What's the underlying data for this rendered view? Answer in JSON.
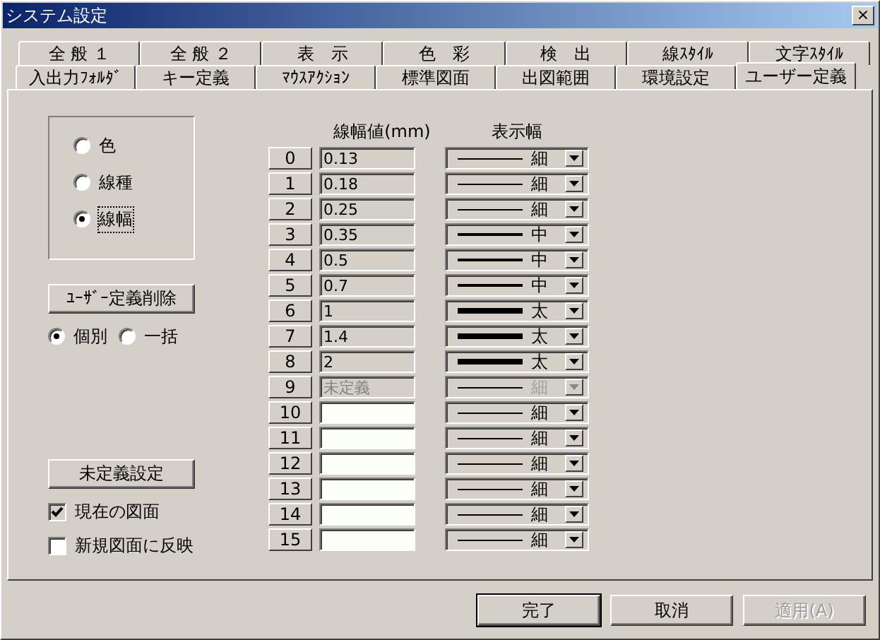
{
  "window": {
    "title": "システム設定",
    "close": "×"
  },
  "tab_rows": [
    [
      {
        "label": "全 般 １",
        "selected": false
      },
      {
        "label": "全 般 ２",
        "selected": false
      },
      {
        "label": "表　示",
        "selected": false
      },
      {
        "label": "色　彩",
        "selected": false
      },
      {
        "label": "検　出",
        "selected": false
      },
      {
        "label": "線ｽﾀｲﾙ",
        "selected": false
      },
      {
        "label": "文字ｽﾀｲﾙ",
        "selected": false
      }
    ],
    [
      {
        "label": "入出力ﾌｫﾙﾀﾞ",
        "selected": false
      },
      {
        "label": "キー定義",
        "selected": false
      },
      {
        "label": "ﾏｳｽｱｸｼｮﾝ",
        "selected": false
      },
      {
        "label": "標準図面",
        "selected": false
      },
      {
        "label": "出図範囲",
        "selected": false
      },
      {
        "label": "環境設定",
        "selected": false
      },
      {
        "label": "ユーザー定義",
        "selected": true
      }
    ]
  ],
  "target_options": [
    {
      "label": "色",
      "selected": false
    },
    {
      "label": "線種",
      "selected": false
    },
    {
      "label": "線幅",
      "selected": true
    }
  ],
  "delete_button": "ﾕｰｻﾞｰ定義削除",
  "scope_options": [
    {
      "label": "個別",
      "selected": true
    },
    {
      "label": "一括",
      "selected": false
    }
  ],
  "undefined_button": "未定義設定",
  "checkboxes": [
    {
      "label": "現在の図面",
      "checked": true
    },
    {
      "label": "新規図面に反映",
      "checked": false
    }
  ],
  "table": {
    "columns": [
      "線幅値(mm)",
      "表示幅"
    ],
    "rows": [
      {
        "number": "0",
        "value": "0.13",
        "read_only": true,
        "disabled": false,
        "kind": "thin",
        "width_label": "細"
      },
      {
        "number": "1",
        "value": "0.18",
        "read_only": true,
        "disabled": false,
        "kind": "thin",
        "width_label": "細"
      },
      {
        "number": "2",
        "value": "0.25",
        "read_only": true,
        "disabled": false,
        "kind": "thin",
        "width_label": "細"
      },
      {
        "number": "3",
        "value": "0.35",
        "read_only": true,
        "disabled": false,
        "kind": "medium",
        "width_label": "中"
      },
      {
        "number": "4",
        "value": "0.5",
        "read_only": true,
        "disabled": false,
        "kind": "medium",
        "width_label": "中"
      },
      {
        "number": "5",
        "value": "0.7",
        "read_only": true,
        "disabled": false,
        "kind": "medium",
        "width_label": "中"
      },
      {
        "number": "6",
        "value": "1",
        "read_only": true,
        "disabled": false,
        "kind": "thick",
        "width_label": "太"
      },
      {
        "number": "7",
        "value": "1.4",
        "read_only": true,
        "disabled": false,
        "kind": "thick",
        "width_label": "太"
      },
      {
        "number": "8",
        "value": "2",
        "read_only": true,
        "disabled": false,
        "kind": "thick",
        "width_label": "太"
      },
      {
        "number": "9",
        "value": "未定義",
        "read_only": true,
        "disabled": true,
        "kind": "thin",
        "width_label": "細"
      },
      {
        "number": "10",
        "read_only": false,
        "disabled": false,
        "kind": "thin",
        "width_label": "細"
      },
      {
        "number": "11",
        "read_only": false,
        "disabled": false,
        "kind": "thin",
        "width_label": "細"
      },
      {
        "number": "12",
        "read_only": false,
        "disabled": false,
        "kind": "thin",
        "width_label": "細"
      },
      {
        "number": "13",
        "read_only": false,
        "disabled": false,
        "kind": "thin",
        "width_label": "細"
      },
      {
        "number": "14",
        "read_only": false,
        "disabled": false,
        "kind": "thin",
        "width_label": "細"
      },
      {
        "number": "15",
        "read_only": false,
        "disabled": false,
        "kind": "thin",
        "width_label": "細"
      }
    ]
  },
  "footer_buttons": [
    {
      "label": "完了",
      "kind": "default"
    },
    {
      "label": "取消",
      "kind": "normal"
    },
    {
      "label": "適用(A)",
      "kind": "disabled"
    }
  ]
}
